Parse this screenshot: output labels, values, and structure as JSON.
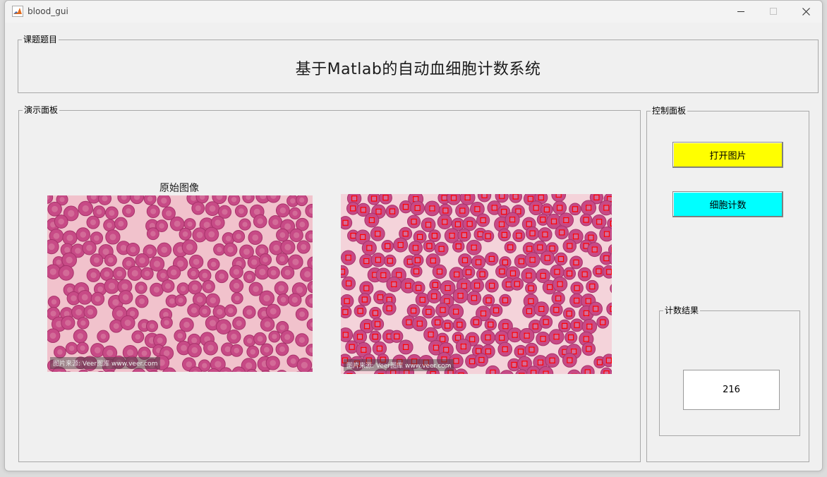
{
  "window": {
    "title": "blood_gui"
  },
  "topic_panel": {
    "legend": "课题题目",
    "title": "基于Matlab的自动血细胞计数系统"
  },
  "demo_panel": {
    "legend": "演示面板",
    "original_title": "原始图像",
    "original_watermark": "图片来源: Veer图库 www.veer.com",
    "processed_watermark": "图片来源: Veer图库 www.veer.com"
  },
  "control_panel": {
    "legend": "控制面板",
    "open_button": "打开图片",
    "count_button": "细胞计数",
    "open_color": "#ffff00",
    "count_color": "#00ffff"
  },
  "result_panel": {
    "legend": "计数结果",
    "value": "216"
  },
  "colors": {
    "cell": "#c74a86",
    "cell_dark": "#a8336b",
    "background": "#f1c2cc",
    "marker": "#ff0000"
  }
}
